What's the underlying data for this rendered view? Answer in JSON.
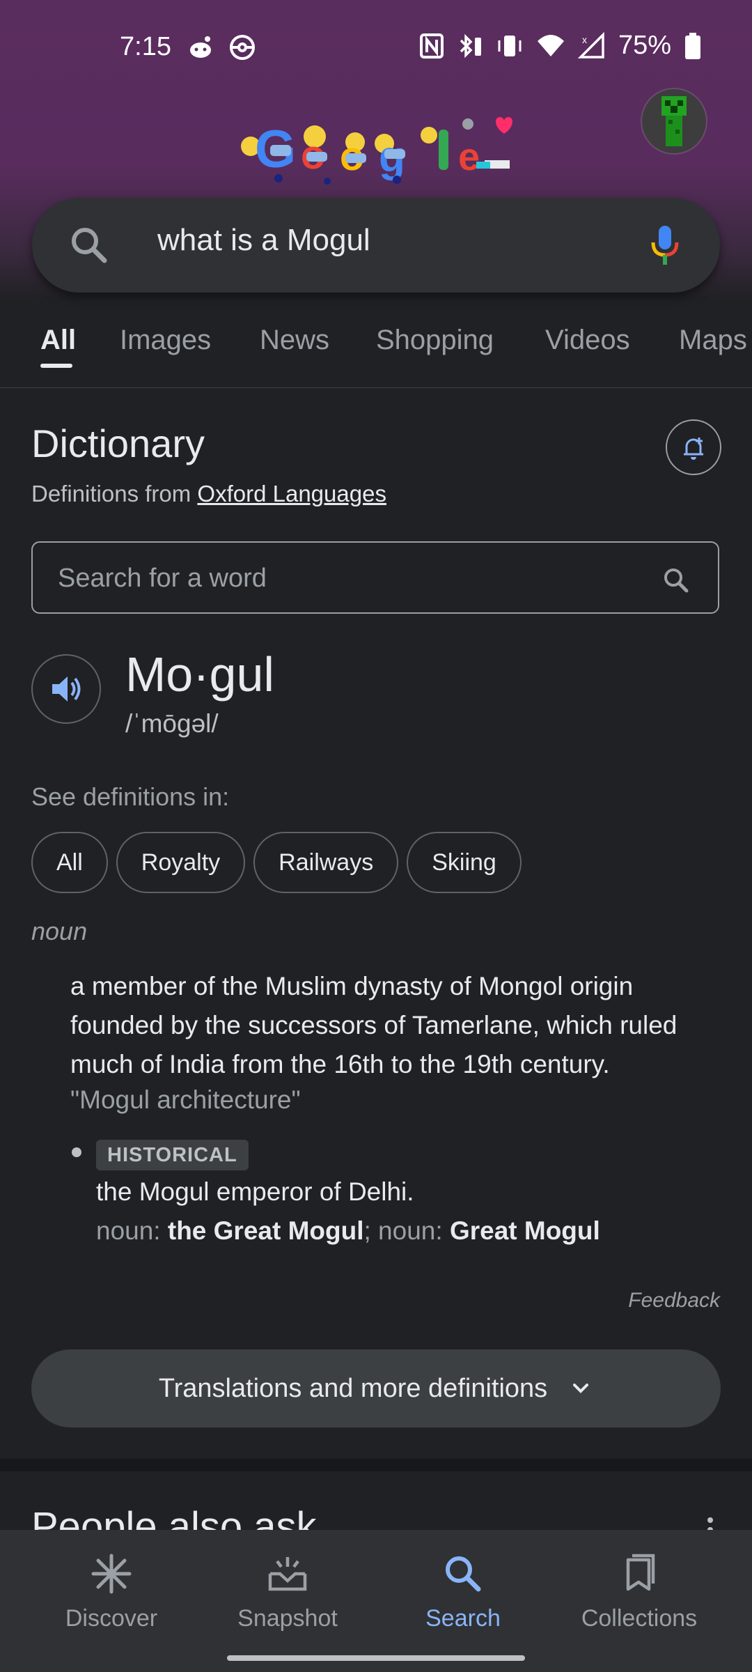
{
  "status": {
    "time": "7:15",
    "battery": "75%"
  },
  "search": {
    "query": "what is a Mogul"
  },
  "tabs": [
    "All",
    "Images",
    "News",
    "Shopping",
    "Videos",
    "Maps"
  ],
  "dictionary": {
    "title": "Dictionary",
    "source_prefix": "Definitions from ",
    "source_link": "Oxford Languages",
    "word_search_placeholder": "Search for a word",
    "headword": "Mo·gul",
    "phonetic": "/ˈmōɡəl/",
    "see_definitions": "See definitions in:",
    "chips": [
      "All",
      "Royalty",
      "Railways",
      "Skiing"
    ],
    "part_of_speech": "noun",
    "definition": "a member of the Muslim dynasty of Mongol origin founded by the successors of Tamerlane, which ruled much of India from the 16th to the 19th century.",
    "example": "\"Mogul architecture\"",
    "sub_label": "HISTORICAL",
    "sub_definition": "the Mogul emperor of Delhi.",
    "noun_prefix_1": "noun: ",
    "noun_term_1": "the Great Mogul",
    "noun_sep": "; noun: ",
    "noun_term_2": "Great Mogul",
    "feedback": "Feedback",
    "more_button": "Translations and more definitions"
  },
  "people_also_ask": "People also ask",
  "bottom_nav": [
    "Discover",
    "Snapshot",
    "Search",
    "Collections"
  ],
  "colors": {
    "accent": "#8ab4f8",
    "background": "#202124",
    "header": "#5a2d5f"
  }
}
